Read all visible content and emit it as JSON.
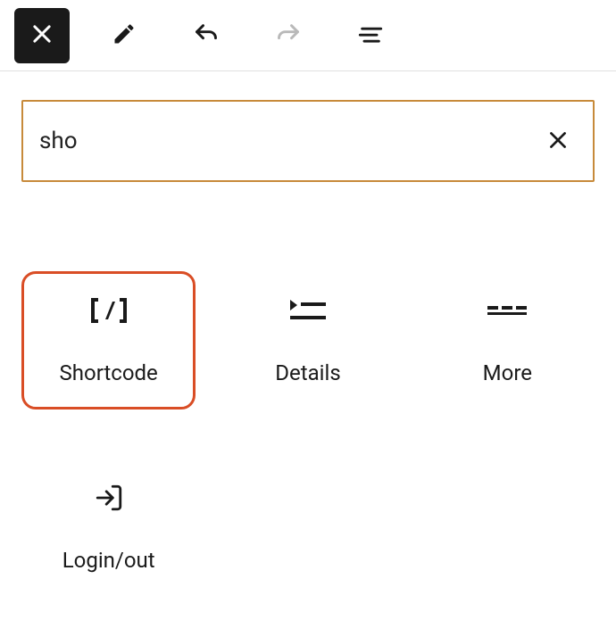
{
  "search": {
    "value": "sho"
  },
  "blocks": [
    {
      "label": "Shortcode",
      "icon": "shortcode",
      "selected": true
    },
    {
      "label": "Details",
      "icon": "details",
      "selected": false
    },
    {
      "label": "More",
      "icon": "more",
      "selected": false
    },
    {
      "label": "Login/out",
      "icon": "login",
      "selected": false
    }
  ]
}
